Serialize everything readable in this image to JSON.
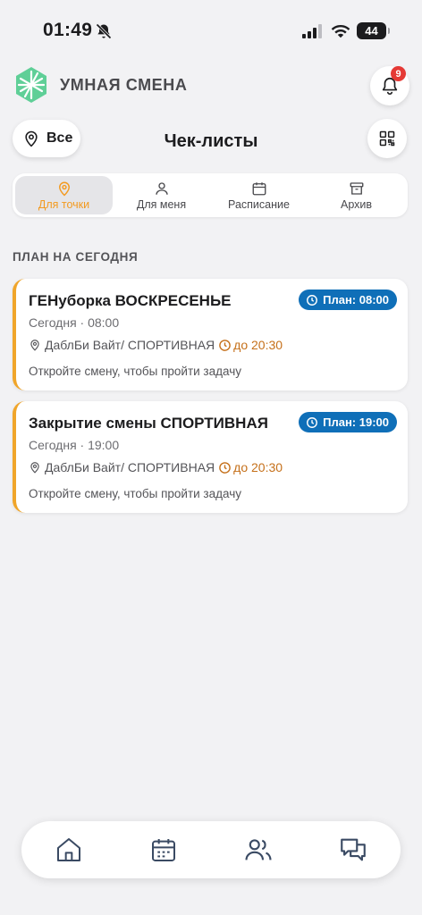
{
  "status_bar": {
    "time": "01:49",
    "battery": "44"
  },
  "header": {
    "brand": "УМНАЯ СМЕНА",
    "notifications_count": "9",
    "brand_colors": [
      "#7dd8a8",
      "#3fbf8a"
    ]
  },
  "filter": {
    "location_label": "Все"
  },
  "page_title": "Чек-листы",
  "segments": [
    {
      "label": "Для точки",
      "icon": "map-pin-icon",
      "active": true
    },
    {
      "label": "Для меня",
      "icon": "user-icon",
      "active": false
    },
    {
      "label": "Расписание",
      "icon": "calendar-icon",
      "active": false
    },
    {
      "label": "Архив",
      "icon": "archive-icon",
      "active": false
    }
  ],
  "section_title": "ПЛАН НА СЕГОДНЯ",
  "tasks": [
    {
      "title": "ГЕНуборка ВОСКРЕСЕНЬЕ",
      "plan": "План: 08:00",
      "when": "Сегодня · 08:00",
      "place": "ДаблБи Вайт/ СПОРТИВНАЯ",
      "deadline": "до 20:30",
      "hint": "Откройте смену, чтобы пройти задачу"
    },
    {
      "title": "Закрытие смены СПОРТИВНАЯ",
      "plan": "План: 19:00",
      "when": "Сегодня · 19:00",
      "place": "ДаблБи Вайт/ СПОРТИВНАЯ",
      "deadline": "до 20:30",
      "hint": "Откройте смену, чтобы пройти задачу"
    }
  ],
  "colors": {
    "accent": "#f39a1f",
    "badge": "#0f6fb8",
    "card_border": "#f0a52a",
    "deadline": "#c5701a"
  },
  "bottom_nav": [
    {
      "icon": "home-icon"
    },
    {
      "icon": "calendar-icon"
    },
    {
      "icon": "users-icon"
    },
    {
      "icon": "chat-icon"
    }
  ]
}
